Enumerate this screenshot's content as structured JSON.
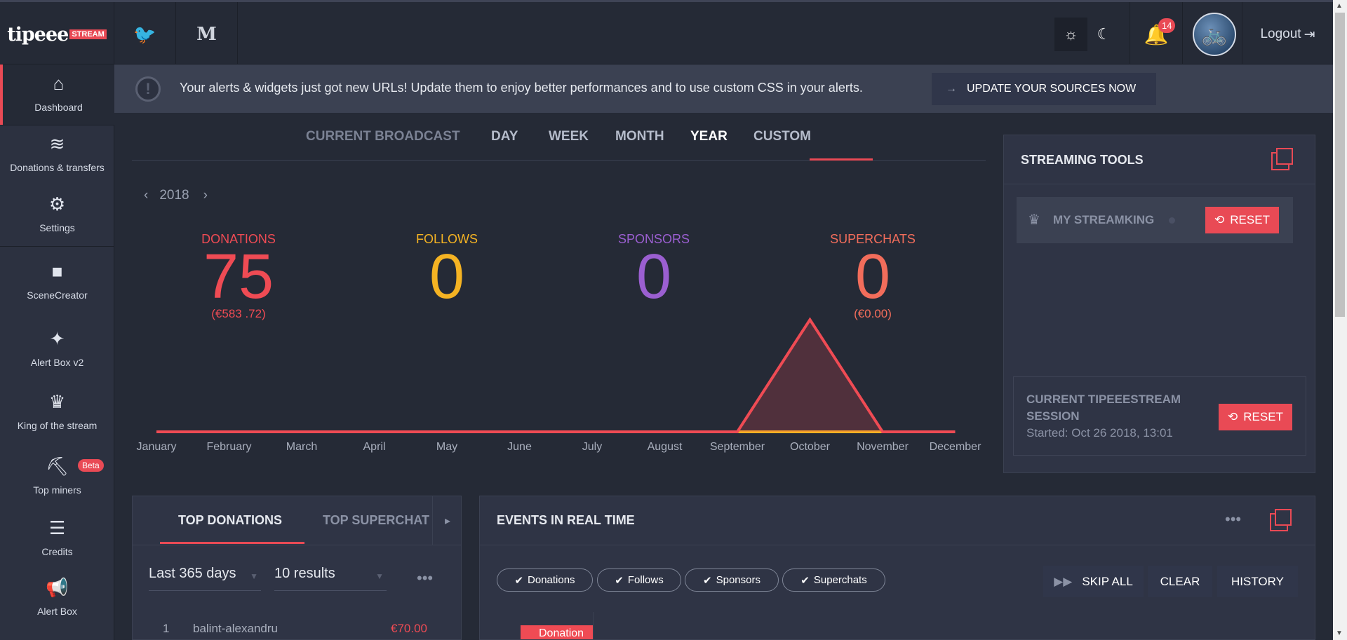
{
  "header": {
    "logo_text": "tipeee",
    "logo_badge": "STREAM",
    "twitter_icon": "twitter-icon",
    "medium_label": "M",
    "notifications_count": "14",
    "logout_label": "Logout"
  },
  "sidebar": {
    "items": [
      {
        "label": "Dashboard",
        "icon": "home-icon"
      },
      {
        "label": "Donations & transfers",
        "icon": "coins-icon"
      },
      {
        "label": "Settings",
        "icon": "gear-icon"
      },
      {
        "label": "SceneCreator",
        "icon": "puzzle-icon"
      },
      {
        "label": "Alert Box v2",
        "icon": "alert-box-icon"
      },
      {
        "label": "King of the stream",
        "icon": "trophy-icon"
      },
      {
        "label": "Top miners",
        "icon": "pickaxe-icon"
      },
      {
        "label": "Credits",
        "icon": "credits-icon"
      },
      {
        "label": "Alert Box",
        "icon": "megaphone-icon"
      }
    ],
    "beta_label": "Beta"
  },
  "alert": {
    "message": "Your alerts & widgets just got new URLs! Update them to enjoy better performances and to use custom CSS in your alerts.",
    "button": "UPDATE YOUR SOURCES NOW"
  },
  "period_tabs": [
    "CURRENT BROADCAST",
    "DAY",
    "WEEK",
    "MONTH",
    "YEAR",
    "CUSTOM"
  ],
  "active_tab": "YEAR",
  "year": "2018",
  "stats": {
    "donations": {
      "label": "DONATIONS",
      "value": "75",
      "sub": "(€583 .72)",
      "color": "#ef4b54"
    },
    "follows": {
      "label": "FOLLOWS",
      "value": "0",
      "color": "#f5b323"
    },
    "sponsors": {
      "label": "SPONSORS",
      "value": "0",
      "color": "#9b5fd1"
    },
    "superchats": {
      "label": "SUPERCHATS",
      "value": "0",
      "sub": "(€0.00)",
      "color": "#f26d5b"
    }
  },
  "chart_data": {
    "type": "area",
    "categories": [
      "January",
      "February",
      "March",
      "April",
      "May",
      "June",
      "July",
      "August",
      "September",
      "October",
      "November",
      "December"
    ],
    "series": [
      {
        "values": [
          0,
          0,
          0,
          0,
          0,
          0,
          0,
          0,
          0,
          75,
          0,
          0
        ],
        "color": "#ef4b54"
      },
      {
        "values": [
          0,
          0,
          0,
          0,
          0,
          0,
          0,
          0,
          0,
          0,
          0,
          0
        ],
        "color": "#f5b323"
      }
    ],
    "ylim": [
      0,
      75
    ],
    "grid": false
  },
  "streaming_tools": {
    "title": "STREAMING TOOLS",
    "streamking_label": "MY STREAMKING",
    "reset": "RESET",
    "session_title": "CURRENT TIPEEESTREAM SESSION",
    "session_started": "Started: Oct 26 2018, 13:01"
  },
  "top_panel": {
    "tabs": [
      "TOP DONATIONS",
      "TOP SUPERCHAT"
    ],
    "range": "Last 365 days",
    "results": "10 results",
    "rows": [
      {
        "rank": "1",
        "name": "balint-alexandru",
        "amount": "€70.00"
      }
    ]
  },
  "events": {
    "title": "EVENTS IN REAL TIME",
    "filters": [
      "Donations",
      "Follows",
      "Sponsors",
      "Superchats"
    ],
    "skip_all": "SKIP ALL",
    "clear": "CLEAR",
    "history": "HISTORY",
    "first_event_type": "Donation"
  }
}
